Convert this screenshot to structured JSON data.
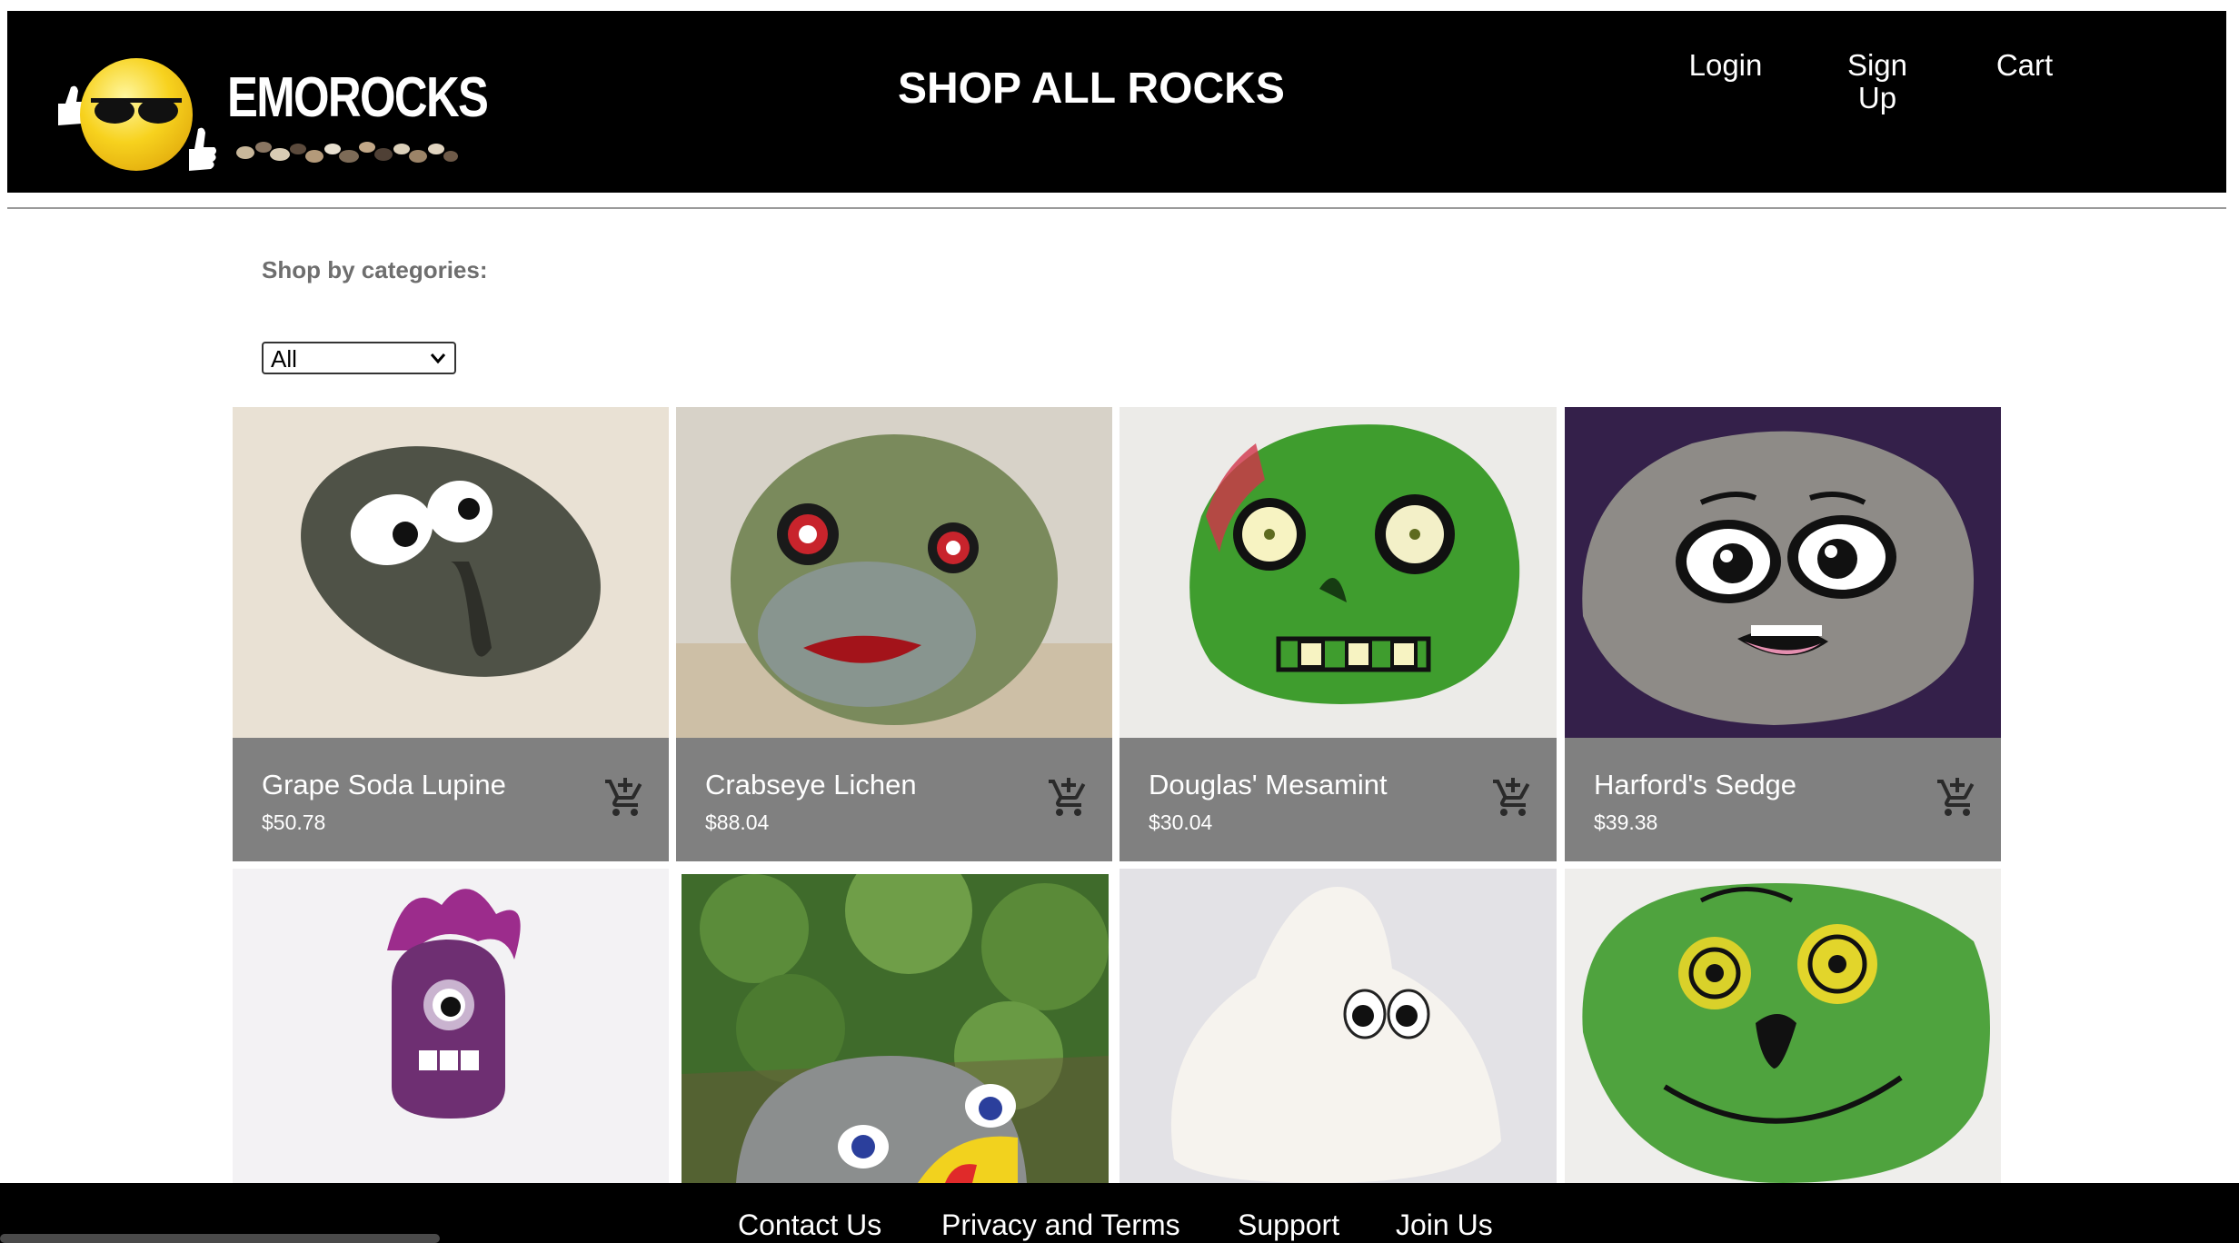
{
  "header": {
    "logo_text": "EMOROCKS",
    "title": "SHOP ALL ROCKS",
    "nav": {
      "login": "Login",
      "signup": "Sign Up",
      "cart": "Cart"
    }
  },
  "categories": {
    "label": "Shop by categories:",
    "selected": "All"
  },
  "products": [
    {
      "name": "Grape Soda Lupine",
      "price": "$50.78"
    },
    {
      "name": "Crabseye Lichen",
      "price": "$88.04"
    },
    {
      "name": "Douglas' Mesamint",
      "price": "$30.04"
    },
    {
      "name": "Harford's Sedge",
      "price": "$39.38"
    }
  ],
  "footer": {
    "links": [
      "Contact Us",
      "Privacy and Terms",
      "Support",
      "Join Us"
    ]
  },
  "icons": {
    "add_to_cart": "add-shopping-cart-icon",
    "select_caret": "chevron-down-icon"
  },
  "colors": {
    "header_bg": "#000000",
    "card_info_bg": "#808080",
    "footer_bg": "#000000"
  }
}
